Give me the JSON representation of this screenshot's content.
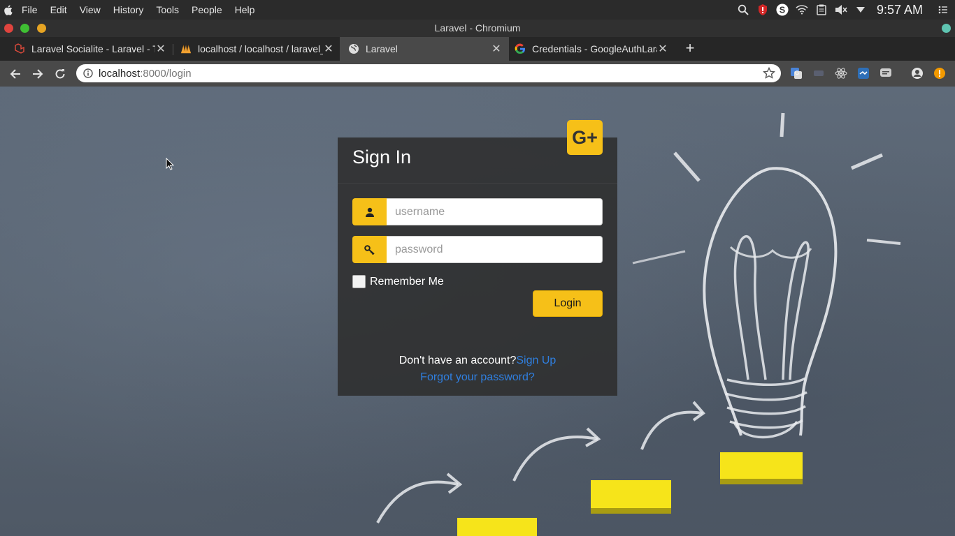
{
  "os_menu": {
    "items": [
      "File",
      "Edit",
      "View",
      "History",
      "Tools",
      "People",
      "Help"
    ],
    "clock": "9:57 AM"
  },
  "window": {
    "title": "Laravel - Chromium"
  },
  "tabs": [
    {
      "label": "Laravel Socialite - Laravel - The",
      "icon": "laravel-icon"
    },
    {
      "label": "localhost / localhost / laravel_",
      "icon": "phpmyadmin-icon"
    },
    {
      "label": "Laravel",
      "icon": "globe-icon",
      "active": true
    },
    {
      "label": "Credentials - GoogleAuthLara",
      "icon": "google-icon"
    }
  ],
  "address_bar": {
    "host": "localhost",
    "path": ":8000/login"
  },
  "login": {
    "title": "Sign In",
    "google_label": "G+",
    "username_placeholder": "username",
    "password_placeholder": "password",
    "remember_label": "Remember Me",
    "login_button": "Login",
    "no_account_text": "Don't have an account?",
    "signup_link": "Sign Up",
    "forgot_link": "Forgot your password?"
  },
  "colors": {
    "accent": "#f6c018",
    "link": "#2f7fe0",
    "card_bg": "#2d2d2d"
  }
}
